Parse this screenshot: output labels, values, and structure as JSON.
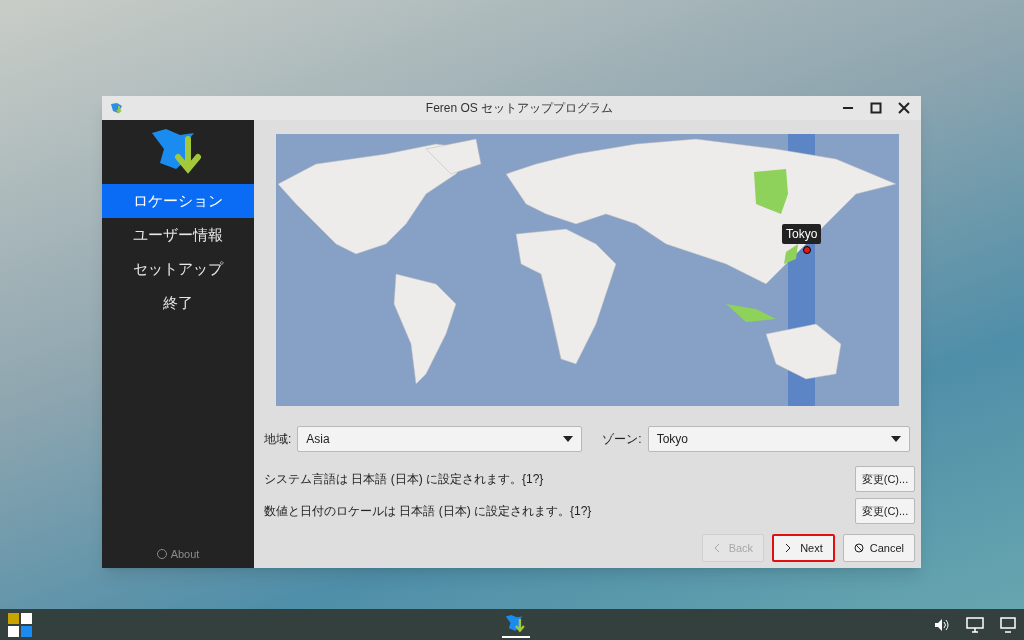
{
  "window": {
    "title": "Feren OS セットアッププログラム"
  },
  "sidebar": {
    "items": [
      {
        "label": "ロケーション",
        "selected": true
      },
      {
        "label": "ユーザー情報",
        "selected": false
      },
      {
        "label": "セットアップ",
        "selected": false
      },
      {
        "label": "終了",
        "selected": false
      }
    ],
    "about": "About"
  },
  "map": {
    "marker_label": "Tokyo"
  },
  "region": {
    "label": "地域:",
    "value": "Asia"
  },
  "zone": {
    "label": "ゾーン:",
    "value": "Tokyo"
  },
  "locale_rows": [
    {
      "text": "システム言語は 日本語 (日本) に設定されます。{1?}",
      "button": "変更(C)..."
    },
    {
      "text": "数値と日付のロケールは 日本語 (日本) に設定されます。{1?}",
      "button": "変更(C)..."
    }
  ],
  "buttons": [
    {
      "kind": "back",
      "label": "Back",
      "disabled": true,
      "highlighted": false
    },
    {
      "kind": "next",
      "label": "Next",
      "disabled": false,
      "highlighted": true
    },
    {
      "kind": "cancel",
      "label": "Cancel",
      "disabled": false,
      "highlighted": false
    }
  ]
}
